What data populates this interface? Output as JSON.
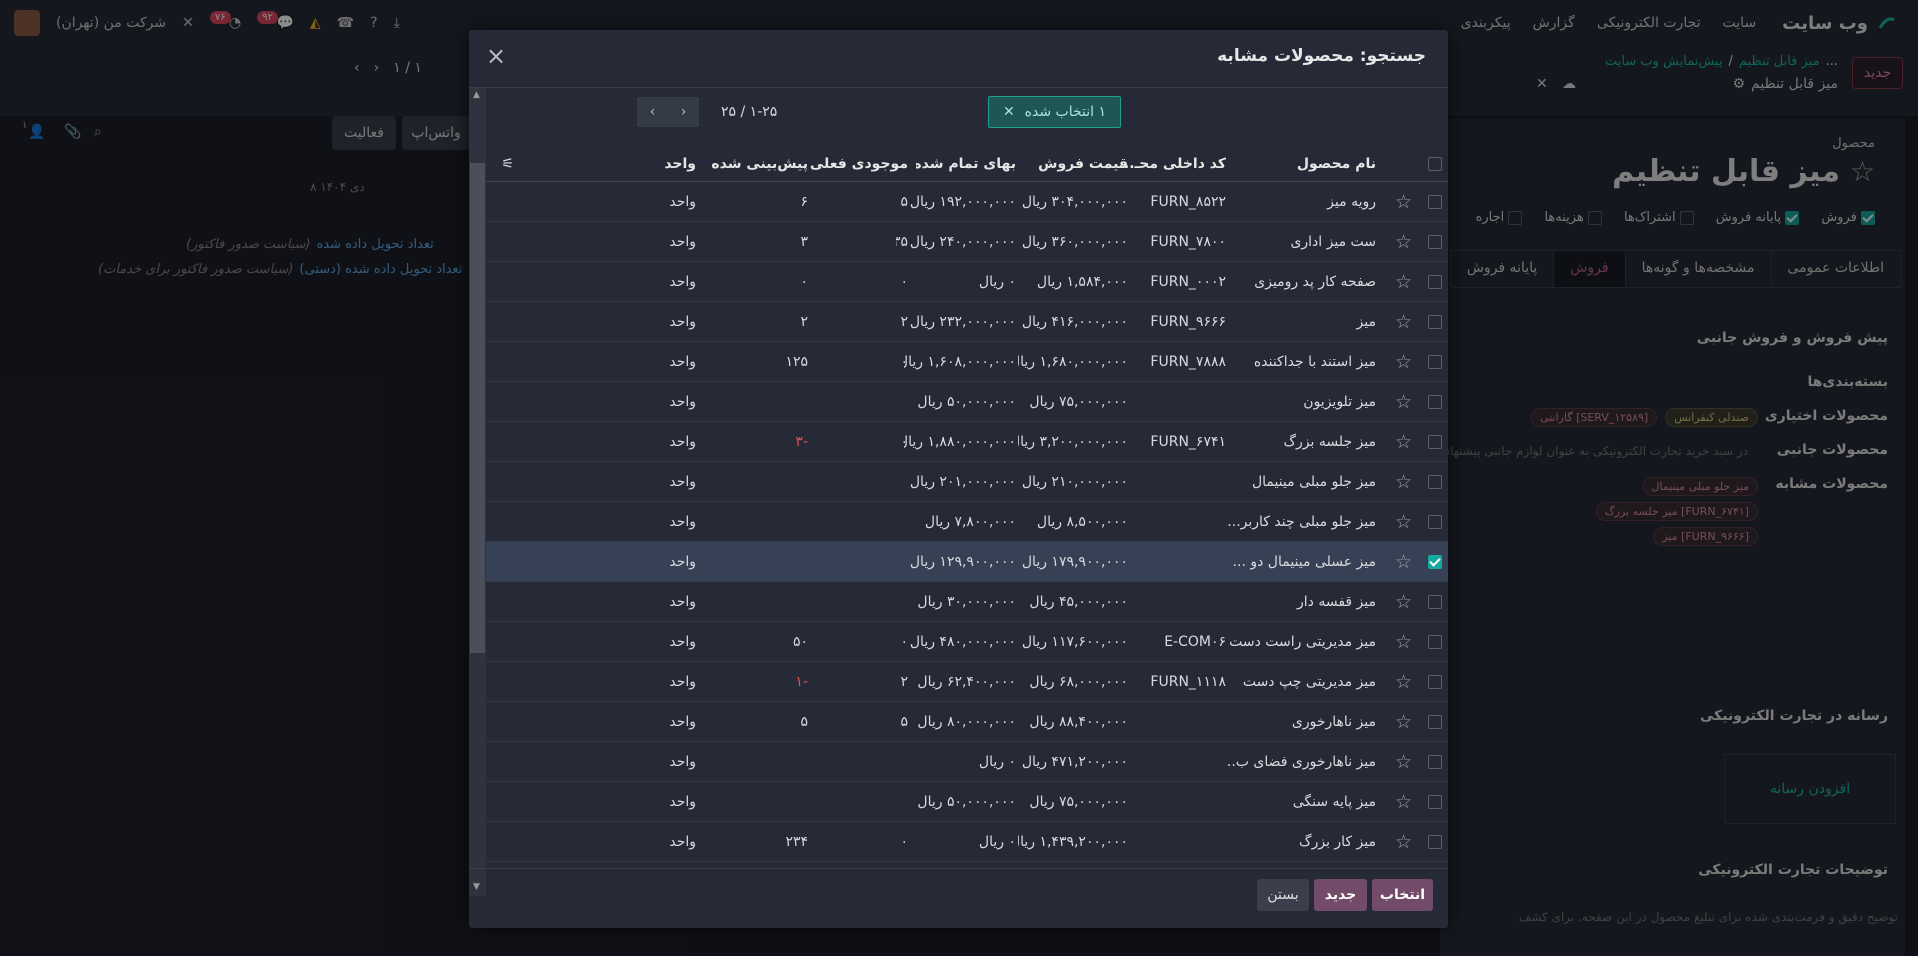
{
  "navbar": {
    "brand": "وب سایت",
    "menu": [
      "سایت",
      "تجارت الکترونیکی",
      "گزارش",
      "پیکربندی"
    ],
    "company": "شرکت من (تهران)",
    "badge_activity": "۷۶",
    "badge_messages": "۹۲"
  },
  "background": {
    "new_button": "جدید",
    "breadcrumb_parent": "میز قابل تنظیم",
    "breadcrumb_preview": "پیش‌نمایش وب سایت",
    "breadcrumb_ellipsis": "...",
    "record_title_small": "میز قابل تنظیم",
    "pager": "۱ / ۱",
    "chatter_whatsapp": "واتس‌اپ",
    "chatter_activity": "فعالیت",
    "chatter_date": "۸ دی ۱۴۰۴",
    "chatter_line1_link": "تعداد تحویل داده شده",
    "chatter_line1_note": "(سیاست صدور فاکتور)",
    "chatter_line2_link": "تعداد تحویل داده شده (دستی)",
    "chatter_line2_note": "(سیاست صدور فاکتور برای خدمات)",
    "chatter_count": "۱",
    "product_label": "محصول",
    "product_name": "میز قابل تنظیم",
    "flags": [
      "فروش",
      "پایانه فروش",
      "اشتراک‌ها",
      "هزینه‌ها",
      "اجاره"
    ],
    "tabs": [
      "اطلاعات عمومی",
      "مشخصه‌ها و گونه‌ها",
      "فروش",
      "پایانه فروش"
    ],
    "section_upsell": "پیش فروش و فروش جانبی",
    "field_packaging": "بسته‌بندی‌ها",
    "field_optional": "محصولات اختیاری",
    "optional_tags": [
      "صندلی کنفرانس",
      "[SERV_۱۲۵۸۹] گارانتی"
    ],
    "field_accessory": "محصولات جانبی",
    "accessory_placeholder": "در سبد خرید تجارت الکترونیکی به عنوان لوازم جانبی پیشنهاد شود",
    "field_alternative": "محصولات مشابه",
    "alternative_tags": [
      "میز جلو مبلی مینیمال",
      "[FURN_۶۷۴۱] میز جلسه بزرگ",
      "[FURN_۹۶۶۶] میز"
    ],
    "section_media": "رسانه در تجارت الکترونیکی",
    "add_media": "افزودن رسانه",
    "section_desc": "توضیحات تجارت الکترونیکی",
    "desc_placeholder": "توضیح دقیق و فرمت‌بندی شده برای تبلیغ محصول در این صفحه. برای کشف"
  },
  "dialog": {
    "title": "جستجو: محصولات مشابه",
    "selected_label": "۱ انتخاب شده",
    "pager": "۱-۲۵ / ۲۵",
    "columns": [
      "نام محصول",
      "کد داخلی محـ...",
      "قیمت فروش",
      "بهای تمام شده",
      "موجودی فعلی",
      "پیش‌بینی شده",
      "واحد"
    ],
    "rows": [
      {
        "name": "رویه میز",
        "code": "FURN_۸۵۲۲",
        "price": "۳۰۴,۰۰۰,۰۰۰ ریال",
        "cost": "۱۹۲,۰۰۰,۰۰۰ ریال",
        "onhand": "۵",
        "forecast": "۶",
        "uom": "واحد"
      },
      {
        "name": "ست میز اداری",
        "code": "FURN_۷۸۰۰",
        "price": "۳۶۰,۰۰۰,۰۰۰ ریال",
        "cost": "۲۴۰,۰۰۰,۰۰۰ ریال",
        "onhand": "۲۳۵",
        "forecast": "۳",
        "uom": "واحد"
      },
      {
        "name": "صفحه کار پد رومیزی",
        "code": "FURN_۰۰۰۲",
        "price": "۱,۵۸۴,۰۰۰ ریال",
        "cost": "۰ ریال",
        "onhand": "۰",
        "forecast": "۰",
        "uom": "واحد"
      },
      {
        "name": "میز",
        "code": "FURN_۹۶۶۶",
        "price": "۴۱۶,۰۰۰,۰۰۰ ریال",
        "cost": "۲۳۲,۰۰۰,۰۰۰ ریال",
        "onhand": "۲",
        "forecast": "۲",
        "uom": "واحد"
      },
      {
        "name": "میز استند با جداکننده",
        "code": "FURN_۷۸۸۸",
        "price": "۱,۶۸۰,۰۰۰,۰۰۰ ریال",
        "cost": "۱,۶۰۸,۰۰۰,۰۰۰ ریال",
        "onhand": "۰",
        "forecast": "۱۲۵",
        "uom": "واحد"
      },
      {
        "name": "میز تلویزیون",
        "code": "",
        "price": "۷۵,۰۰۰,۰۰۰ ریال",
        "cost": "۵۰,۰۰۰,۰۰۰ ریال",
        "onhand": "",
        "forecast": "",
        "uom": "واحد"
      },
      {
        "name": "میز جلسه بزرگ",
        "code": "FURN_۶۷۴۱",
        "price": "۳,۲۰۰,۰۰۰,۰۰۰ ریال",
        "cost": "۱,۸۸۰,۰۰۰,۰۰۰ ریال",
        "onhand": "۰",
        "forecast": "-۳",
        "uom": "واحد",
        "neg": true
      },
      {
        "name": "میز جلو مبلی مینیمال",
        "code": "",
        "price": "۲۱۰,۰۰۰,۰۰۰ ریال",
        "cost": "۲۰۱,۰۰۰,۰۰۰ ریال",
        "onhand": "",
        "forecast": "",
        "uom": "واحد"
      },
      {
        "name": "میز جلو مبلی چند کاربر...",
        "code": "",
        "price": "۸,۵۰۰,۰۰۰ ریال",
        "cost": "۷,۸۰۰,۰۰۰ ریال",
        "onhand": "",
        "forecast": "",
        "uom": "واحد"
      },
      {
        "name": "میز عسلی مینیمال دو ...",
        "code": "",
        "price": "۱۷۹,۹۰۰,۰۰۰ ریال",
        "cost": "۱۲۹,۹۰۰,۰۰۰ ریال",
        "onhand": "",
        "forecast": "",
        "uom": "واحد",
        "selected": true
      },
      {
        "name": "میز قفسه دار",
        "code": "",
        "price": "۴۵,۰۰۰,۰۰۰ ریال",
        "cost": "۳۰,۰۰۰,۰۰۰ ریال",
        "onhand": "",
        "forecast": "",
        "uom": "واحد"
      },
      {
        "name": "میز مدیریتی راست دست",
        "code": "E-COM۰۶",
        "price": "۱۱۷,۶۰۰,۰۰۰ ریال",
        "cost": "۴۸۰,۰۰۰,۰۰۰ ریال",
        "onhand": "۰",
        "forecast": "۵۰",
        "uom": "واحد"
      },
      {
        "name": "میز مدیریتی چپ دست",
        "code": "FURN_۱۱۱۸",
        "price": "۶۸,۰۰۰,۰۰۰ ریال",
        "cost": "۶۲,۴۰۰,۰۰۰ ریال",
        "onhand": "۲",
        "forecast": "-۱",
        "uom": "واحد",
        "neg": true
      },
      {
        "name": "میز ناهارخوری",
        "code": "",
        "price": "۸۸,۴۰۰,۰۰۰ ریال",
        "cost": "۸۰,۰۰۰,۰۰۰ ریال",
        "onhand": "۵",
        "forecast": "۵",
        "uom": "واحد"
      },
      {
        "name": "میز ناهارخوری فضای ب...",
        "code": "",
        "price": "۴۷۱,۲۰۰,۰۰۰ ریال",
        "cost": "۰ ریال",
        "onhand": "",
        "forecast": "",
        "uom": "واحد"
      },
      {
        "name": "میز پایه سنگی",
        "code": "",
        "price": "۷۵,۰۰۰,۰۰۰ ریال",
        "cost": "۵۰,۰۰۰,۰۰۰ ریال",
        "onhand": "",
        "forecast": "",
        "uom": "واحد"
      },
      {
        "name": "میز کار بزرگ",
        "code": "",
        "price": "۱,۴۳۹,۲۰۰,۰۰۰ ریال",
        "cost": "۰ ریال",
        "onhand": "۰",
        "forecast": "۲۳۴",
        "uom": "واحد"
      }
    ],
    "footer": {
      "select": "انتخاب",
      "new": "جدید",
      "close": "بستن"
    }
  },
  "colors": {
    "primary": "#714B67",
    "teal": "#15a9a0",
    "negative": "#e15151"
  }
}
